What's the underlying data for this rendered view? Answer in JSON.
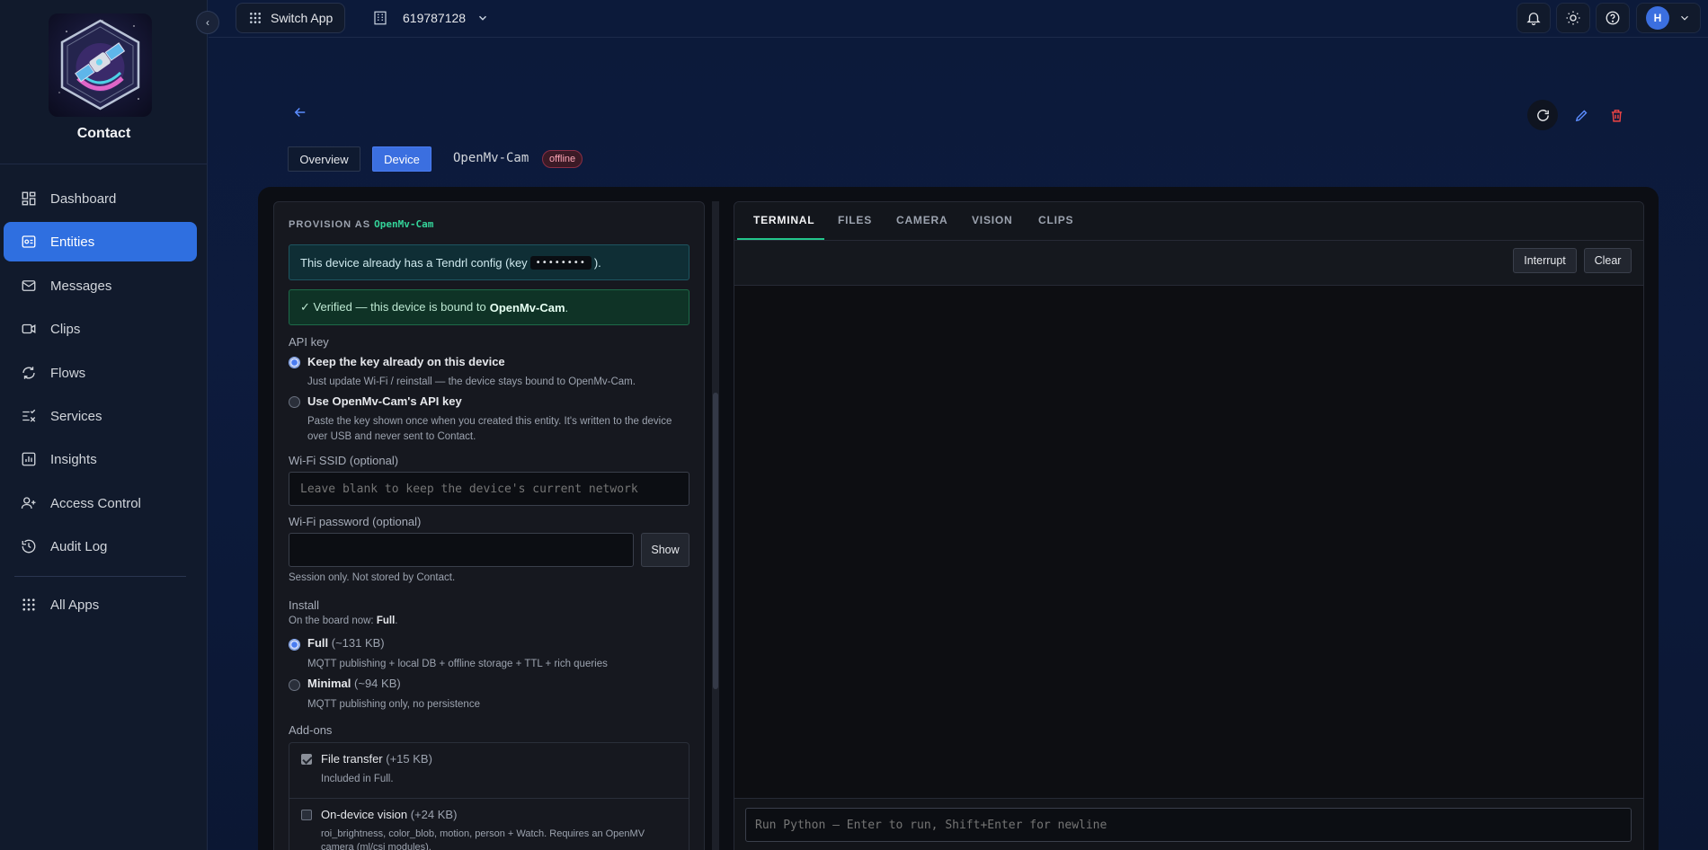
{
  "sidebar": {
    "brand": "Contact",
    "collapse_icon": "chevron-left-icon",
    "items": [
      {
        "label": "Dashboard",
        "icon": "dashboard-icon",
        "active": false
      },
      {
        "label": "Entities",
        "icon": "entities-icon",
        "active": true
      },
      {
        "label": "Messages",
        "icon": "mail-icon",
        "active": false
      },
      {
        "label": "Clips",
        "icon": "video-icon",
        "active": false
      },
      {
        "label": "Flows",
        "icon": "flow-icon",
        "active": false
      },
      {
        "label": "Services",
        "icon": "services-icon",
        "active": false
      },
      {
        "label": "Insights",
        "icon": "chart-icon",
        "active": false
      },
      {
        "label": "Access Control",
        "icon": "users-icon",
        "active": false
      },
      {
        "label": "Audit Log",
        "icon": "history-icon",
        "active": false
      }
    ],
    "all_apps": "All Apps"
  },
  "topbar": {
    "switch_app": "Switch App",
    "org_id": "619787128",
    "avatar_initial": "H"
  },
  "header": {
    "tabs": [
      "Overview",
      "Device"
    ],
    "active_tab": "Device",
    "device_name": "OpenMv-Cam",
    "status": "offline"
  },
  "provision": {
    "title_prefix": "PROVISION AS",
    "title_entity": "OpenMv-Cam",
    "config_notice_pre": "This device already has a Tendrl config (key",
    "config_key": "••••••••",
    "config_notice_post": ").",
    "verified_pre": "✓ Verified — this device is bound to",
    "verified_entity": "OpenMv-Cam",
    "verified_post": ".",
    "api_key_label": "API key",
    "api_options": [
      {
        "title": "Keep the key already on this device",
        "desc": "Just update Wi-Fi / reinstall — the device stays bound to OpenMv-Cam.",
        "selected": true
      },
      {
        "title": "Use OpenMv-Cam's API key",
        "desc": "Paste the key shown once when you created this entity. It's written to the device over USB and never sent to Contact.",
        "selected": false
      }
    ],
    "ssid_label": "Wi-Fi SSID (optional)",
    "ssid_placeholder": "Leave blank to keep the device's current network",
    "password_label": "Wi-Fi password (optional)",
    "password_value": "",
    "show_label": "Show",
    "session_note": "Session only. Not stored by Contact.",
    "install_label": "Install",
    "install_now_pre": "On the board now:",
    "install_now_value": "Full",
    "install_now_post": ".",
    "install_options": [
      {
        "title": "Full",
        "size": "(~131 KB)",
        "desc": "MQTT publishing + local DB + offline storage + TTL + rich queries",
        "selected": true
      },
      {
        "title": "Minimal",
        "size": "(~94 KB)",
        "desc": "MQTT publishing only, no persistence",
        "selected": false
      }
    ],
    "addons_label": "Add-ons",
    "addons": [
      {
        "title": "File transfer",
        "size": "(+15 KB)",
        "desc": "Included in Full.",
        "checked": true
      },
      {
        "title": "On-device vision",
        "size": "(+24 KB)",
        "desc": "roi_brightness, color_blob, motion, person + Watch. Requires an OpenMV camera (ml/csi modules).",
        "checked": false
      }
    ]
  },
  "console": {
    "tabs": [
      "TERMINAL",
      "FILES",
      "CAMERA",
      "VISION",
      "CLIPS"
    ],
    "active_tab": "TERMINAL",
    "interrupt_label": "Interrupt",
    "clear_label": "Clear",
    "input_placeholder": "Run Python — Enter to run, Shift+Enter for newline"
  },
  "colors": {
    "accent": "#3b6fe0",
    "success": "#22c58b",
    "danger": "#ef4444",
    "entity_mono": "#34d399"
  }
}
